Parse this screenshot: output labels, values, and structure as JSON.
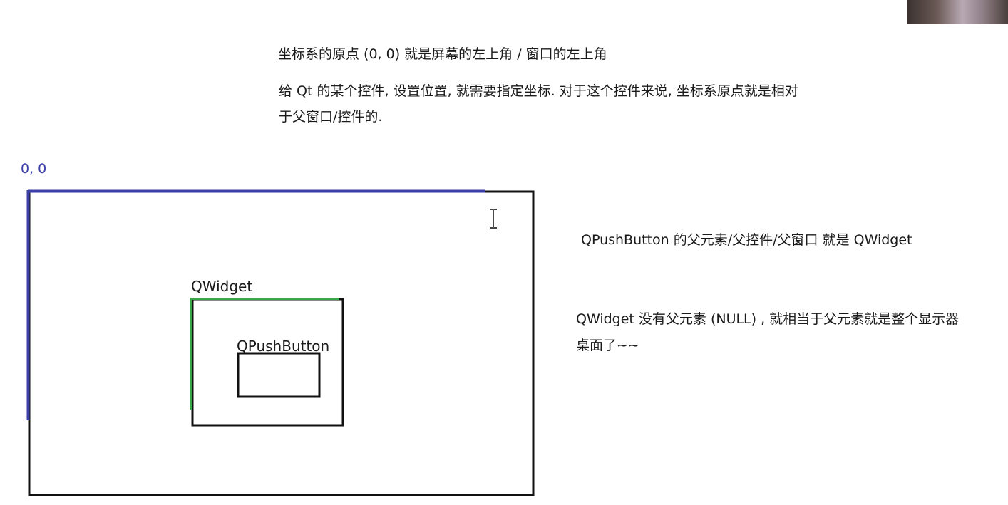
{
  "notes": {
    "origin": "坐标系的原点 (0, 0) 就是屏幕的左上角 / 窗口的左上角",
    "qt_line1": "给 Qt 的某个控件, 设置位置, 就需要指定坐标. 对于这个控件来说, 坐标系原点就是相对",
    "qt_line2": "于父窗口/控件的.",
    "parent": "QPushButton 的父元素/父控件/父窗口 就是 QWidget",
    "qwidget_line1": "QWidget 没有父元素 (NULL) , 就相当于父元素就是整个显示器",
    "qwidget_line2": "桌面了~~"
  },
  "diagram": {
    "origin_label": "0, 0",
    "qwidget_label": "QWidget",
    "qpushbutton_label": "QPushButton"
  },
  "colors": {
    "screen_axis": "#3b3fa6",
    "qwidget_axis": "#3aa84a",
    "frame": "#111111",
    "text": "#1a1a1a"
  },
  "icons": {
    "cursor": "text-cursor-icon",
    "webcam": "webcam-thumbnail"
  }
}
